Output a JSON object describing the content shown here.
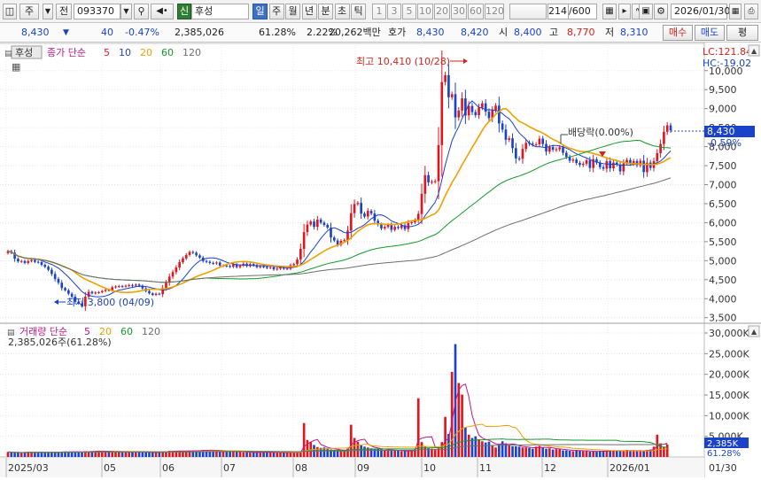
{
  "toolbar": {
    "market_button": "주",
    "type_button": "전",
    "code_value": "093370",
    "tag_label": "신",
    "name_value": "후성",
    "periods": [
      "일",
      "주",
      "월",
      "년",
      "분",
      "초",
      "틱"
    ],
    "period_selected": "일",
    "minutes": [
      "1",
      "3",
      "5",
      "10",
      "20",
      "30",
      "60",
      "120"
    ],
    "count_value": "214",
    "count_total": "/600",
    "date_value": "2026/01/30"
  },
  "quote": {
    "price": "8,430",
    "change_arrow": "▼",
    "change": "40",
    "change_pct": "-0.47%",
    "volume": "2,385,026",
    "vol_ratio": "61.28%",
    "turnover": "2.22%",
    "amount": "20,262백만",
    "ask_label": "호가",
    "ask": "8,430",
    "bid": "8,420",
    "open_label": "시",
    "open": "8,400",
    "high_label": "고",
    "high": "8,770",
    "low_label": "저",
    "low": "8,310",
    "buy_label": "매수",
    "sell_label": "매도",
    "eval_label": "평"
  },
  "price_pane": {
    "name_tag": "후성",
    "legend_main": "종가 단순",
    "ma_periods": [
      "5",
      "10",
      "20",
      "60",
      "120"
    ],
    "ma_colors": [
      "#e0161f",
      "#1a3fd0",
      "#f0a000",
      "#129a2a",
      "#6e6e6e"
    ],
    "lc_label": "LC:121.84",
    "hc_label": "HC:-19.02",
    "high_annotation": "최고 10,410 (10/28)",
    "low_annotation": "최저 3,800 (04/09)",
    "dividend_annotation": "배당락(0.00%)",
    "current_price": "8,430",
    "current_change": "-0.59%"
  },
  "volume_pane": {
    "legend_main": "거래량 단순",
    "ma_periods": [
      "5",
      "20",
      "60",
      "120"
    ],
    "current_volume_text": "2,385,026주(61.28%)",
    "current_tag": "2,385K",
    "current_pct": "61.28%"
  },
  "x_axis": {
    "labels": [
      "2025/03",
      "05",
      "06",
      "07",
      "08",
      "09",
      "10",
      "11",
      "12",
      "2026/01",
      "01/30"
    ]
  },
  "chart_data": {
    "type": "candlestick",
    "price_axis": {
      "ylim": [
        3400,
        10600
      ],
      "ticks": [
        "3,500",
        "4,000",
        "4,500",
        "5,000",
        "5,500",
        "6,000",
        "6,500",
        "7,000",
        "7,500",
        "8,000",
        "8,500",
        "9,000",
        "9,500",
        "10,000"
      ]
    },
    "volume_axis": {
      "ylim": [
        0,
        31500
      ],
      "ticks": [
        "5,000K",
        "10,000K",
        "15,000K",
        "20,000K",
        "25,000K",
        "30,000K"
      ]
    },
    "close_series": [
      5250,
      5210,
      5050,
      4980,
      4990,
      4940,
      4990,
      5020,
      4970,
      4960,
      4890,
      4840,
      4760,
      4650,
      4520,
      4420,
      4280,
      4220,
      4130,
      4050,
      3920,
      3870,
      3800,
      4050,
      4180,
      4140,
      4160,
      4170,
      4200,
      4230,
      4220,
      4300,
      4320,
      4330,
      4320,
      4340,
      4360,
      4340,
      4370,
      4340,
      4270,
      4200,
      4140,
      4100,
      4130,
      4120,
      4280,
      4420,
      4580,
      4700,
      4820,
      4960,
      5060,
      5150,
      5230,
      5210,
      5140,
      5080,
      4990,
      4970,
      4940,
      4930,
      4950,
      4870,
      4870,
      4860,
      4840,
      4900,
      4830,
      4870,
      4920,
      4860,
      4910,
      4880,
      4830,
      4850,
      4840,
      4810,
      4830,
      4770,
      4790,
      4830,
      4790,
      4790,
      4880,
      4910,
      5030,
      5310,
      5750,
      5950,
      6030,
      5890,
      6080,
      6000,
      5940,
      5870,
      5610,
      5530,
      5420,
      5520,
      5540,
      5790,
      6250,
      6490,
      6520,
      6240,
      6160,
      6310,
      6240,
      6050,
      5950,
      5850,
      5890,
      5940,
      5810,
      5890,
      5860,
      5930,
      5830,
      5990,
      6010,
      6070,
      6230,
      6760,
      7250,
      7060,
      7080,
      7090,
      8040,
      9700,
      9880,
      9300,
      9380,
      8770,
      8950,
      9270,
      8820,
      9070,
      8910,
      8830,
      9030,
      9140,
      8920,
      8750,
      8960,
      9080,
      8610,
      8450,
      8180,
      8220,
      7960,
      7690,
      7680,
      7940,
      8100,
      8080,
      8060,
      8060,
      8210,
      8070,
      7870,
      7990,
      7920,
      7930,
      7980,
      7840,
      7730,
      7630,
      7660,
      7570,
      7520,
      7550,
      7640,
      7440,
      7670,
      7580,
      7460,
      7420,
      7620,
      7430,
      7580,
      7530,
      7350,
      7560,
      7650,
      7550,
      7620,
      7510,
      7630,
      7330,
      7580,
      7440,
      7620,
      7830,
      8070,
      8390,
      8560,
      8430
    ],
    "volume_series_k": [
      1210,
      1140,
      1010,
      1010,
      1040,
      1150,
      1250,
      1270,
      1000,
      1030,
      1210,
      1100,
      1210,
      1180,
      1190,
      1130,
      1280,
      1330,
      1260,
      1290,
      1180,
      1250,
      1280,
      1400,
      1370,
      1420,
      1440,
      1410,
      1350,
      1360,
      1420,
      1320,
      1310,
      1280,
      1200,
      1250,
      1200,
      1240,
      1200,
      1240,
      1070,
      1070,
      1080,
      1110,
      1150,
      1200,
      1330,
      1360,
      1480,
      1440,
      1460,
      1460,
      1440,
      1480,
      1500,
      1510,
      1550,
      1610,
      1700,
      1650,
      1590,
      1580,
      1550,
      1520,
      1430,
      1450,
      1320,
      1280,
      1350,
      1260,
      1120,
      1160,
      1050,
      1080,
      1080,
      1160,
      1190,
      1140,
      1110,
      1070,
      1070,
      1090,
      1060,
      1050,
      1060,
      1060,
      1050,
      1130,
      8200,
      4100,
      3600,
      2900,
      2400,
      2200,
      2300,
      1900,
      1800,
      1700,
      1700,
      1500,
      1600,
      2000,
      7800,
      4600,
      3700,
      2800,
      2500,
      2300,
      2100,
      2000,
      1900,
      1800,
      1700,
      1700,
      1600,
      1500,
      1500,
      1400,
      1400,
      1500,
      1600,
      1800,
      14200,
      3600,
      2500,
      2100,
      2000,
      1900,
      2000,
      3600,
      9700,
      5600,
      20600,
      27300,
      17900,
      15100,
      7200,
      5400,
      4600,
      5000,
      4300,
      3800,
      3500,
      3700,
      2700,
      2300,
      3100,
      3800,
      3300,
      2800,
      2600,
      2600,
      2500,
      2300,
      2300,
      2200,
      2000,
      2500,
      2700,
      2300,
      2000,
      2100,
      1800,
      1900,
      1900,
      1600,
      1600,
      1500,
      1400,
      1700,
      1600,
      1400,
      1400,
      1300,
      1300,
      1400,
      1500,
      1500,
      1400,
      1600,
      1500,
      1500,
      1600,
      1400,
      1700,
      1500,
      1500,
      1500,
      1500,
      1500,
      1700,
      1800,
      2500,
      5400,
      3300,
      2400,
      3000
    ]
  }
}
